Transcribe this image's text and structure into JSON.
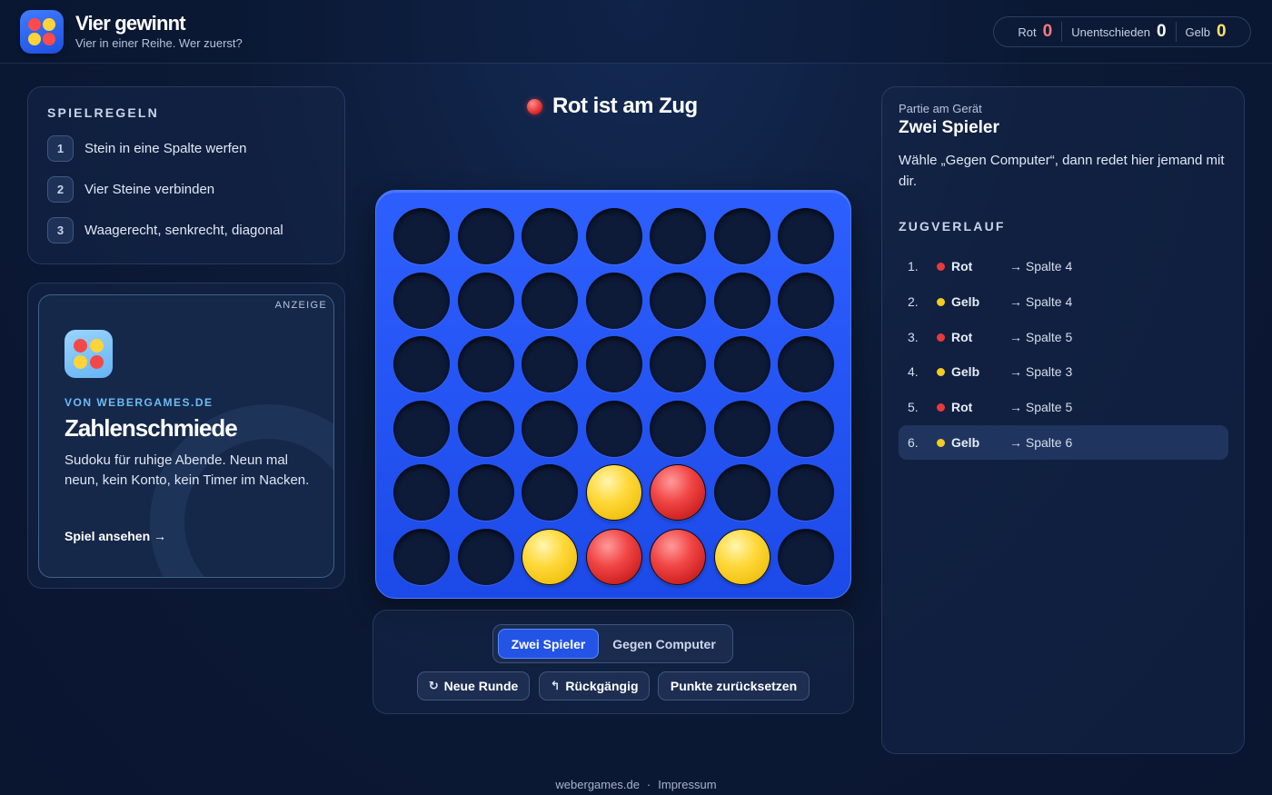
{
  "app": {
    "title": "Vier gewinnt",
    "subtitle": "Vier in einer Reihe. Wer zuerst?"
  },
  "score": {
    "red_label": "Rot",
    "red_value": "0",
    "draw_label": "Unentschieden",
    "draw_value": "0",
    "yellow_label": "Gelb",
    "yellow_value": "0"
  },
  "rules": {
    "title": "SPIELREGELN",
    "items": [
      {
        "num": "1",
        "text": "Stein in eine Spalte werfen"
      },
      {
        "num": "2",
        "text": "Vier Steine verbinden"
      },
      {
        "num": "3",
        "text": "Waagerecht, senkrecht, diagonal"
      }
    ]
  },
  "ad": {
    "label": "ANZEIGE",
    "from": "VON WEBERGAMES.DE",
    "title": "Zahlenschmiede",
    "description": "Sudoku für ruhige Abende. Neun mal neun, kein Konto, kein Timer im Nacken.",
    "link": "Spiel ansehen →"
  },
  "turn": {
    "text": "Rot ist am Zug",
    "player": "red"
  },
  "board": {
    "columns": 7,
    "rows": 6,
    "cells": [
      [
        "",
        "",
        "",
        "",
        "",
        "",
        ""
      ],
      [
        "",
        "",
        "",
        "",
        "",
        "",
        ""
      ],
      [
        "",
        "",
        "",
        "",
        "",
        "",
        ""
      ],
      [
        "",
        "",
        "",
        "",
        "",
        "",
        ""
      ],
      [
        "",
        "",
        "",
        "yellow",
        "red",
        "",
        ""
      ],
      [
        "",
        "",
        "yellow",
        "red",
        "red",
        "yellow",
        ""
      ]
    ]
  },
  "controls": {
    "mode_two_players": "Zwei Spieler",
    "mode_computer": "Gegen Computer",
    "active_mode": "two_players",
    "new_round": "Neue Runde",
    "undo": "Rückgängig",
    "reset_points": "Punkte zurücksetzen"
  },
  "side": {
    "device_label": "Partie am Gerät",
    "mode_title": "Zwei Spieler",
    "mode_description": "Wähle „Gegen Computer“, dann redet hier jemand mit dir.",
    "history_title": "ZUGVERLAUF",
    "moves": [
      {
        "num": "1.",
        "player": "Rot",
        "color": "red",
        "column": "→ Spalte 4"
      },
      {
        "num": "2.",
        "player": "Gelb",
        "color": "yellow",
        "column": "→ Spalte 4"
      },
      {
        "num": "3.",
        "player": "Rot",
        "color": "red",
        "column": "→ Spalte 5"
      },
      {
        "num": "4.",
        "player": "Gelb",
        "color": "yellow",
        "column": "→ Spalte 3"
      },
      {
        "num": "5.",
        "player": "Rot",
        "color": "red",
        "column": "→ Spalte 5"
      },
      {
        "num": "6.",
        "player": "Gelb",
        "color": "yellow",
        "column": "→ Spalte 6"
      }
    ],
    "active_move_index": 5
  },
  "footer": {
    "site": "webergames.de",
    "separator": "·",
    "imprint": "Impressum"
  },
  "colors": {
    "red": "#e83a3a",
    "yellow": "#f5cc1f",
    "board_blue": "#2456f5",
    "score_red": "#ff7a7a",
    "score_yellow": "#ffe066"
  },
  "icons": {
    "new_round": "refresh-icon",
    "undo": "undo-icon",
    "ad_link": "arrow-right-icon"
  }
}
